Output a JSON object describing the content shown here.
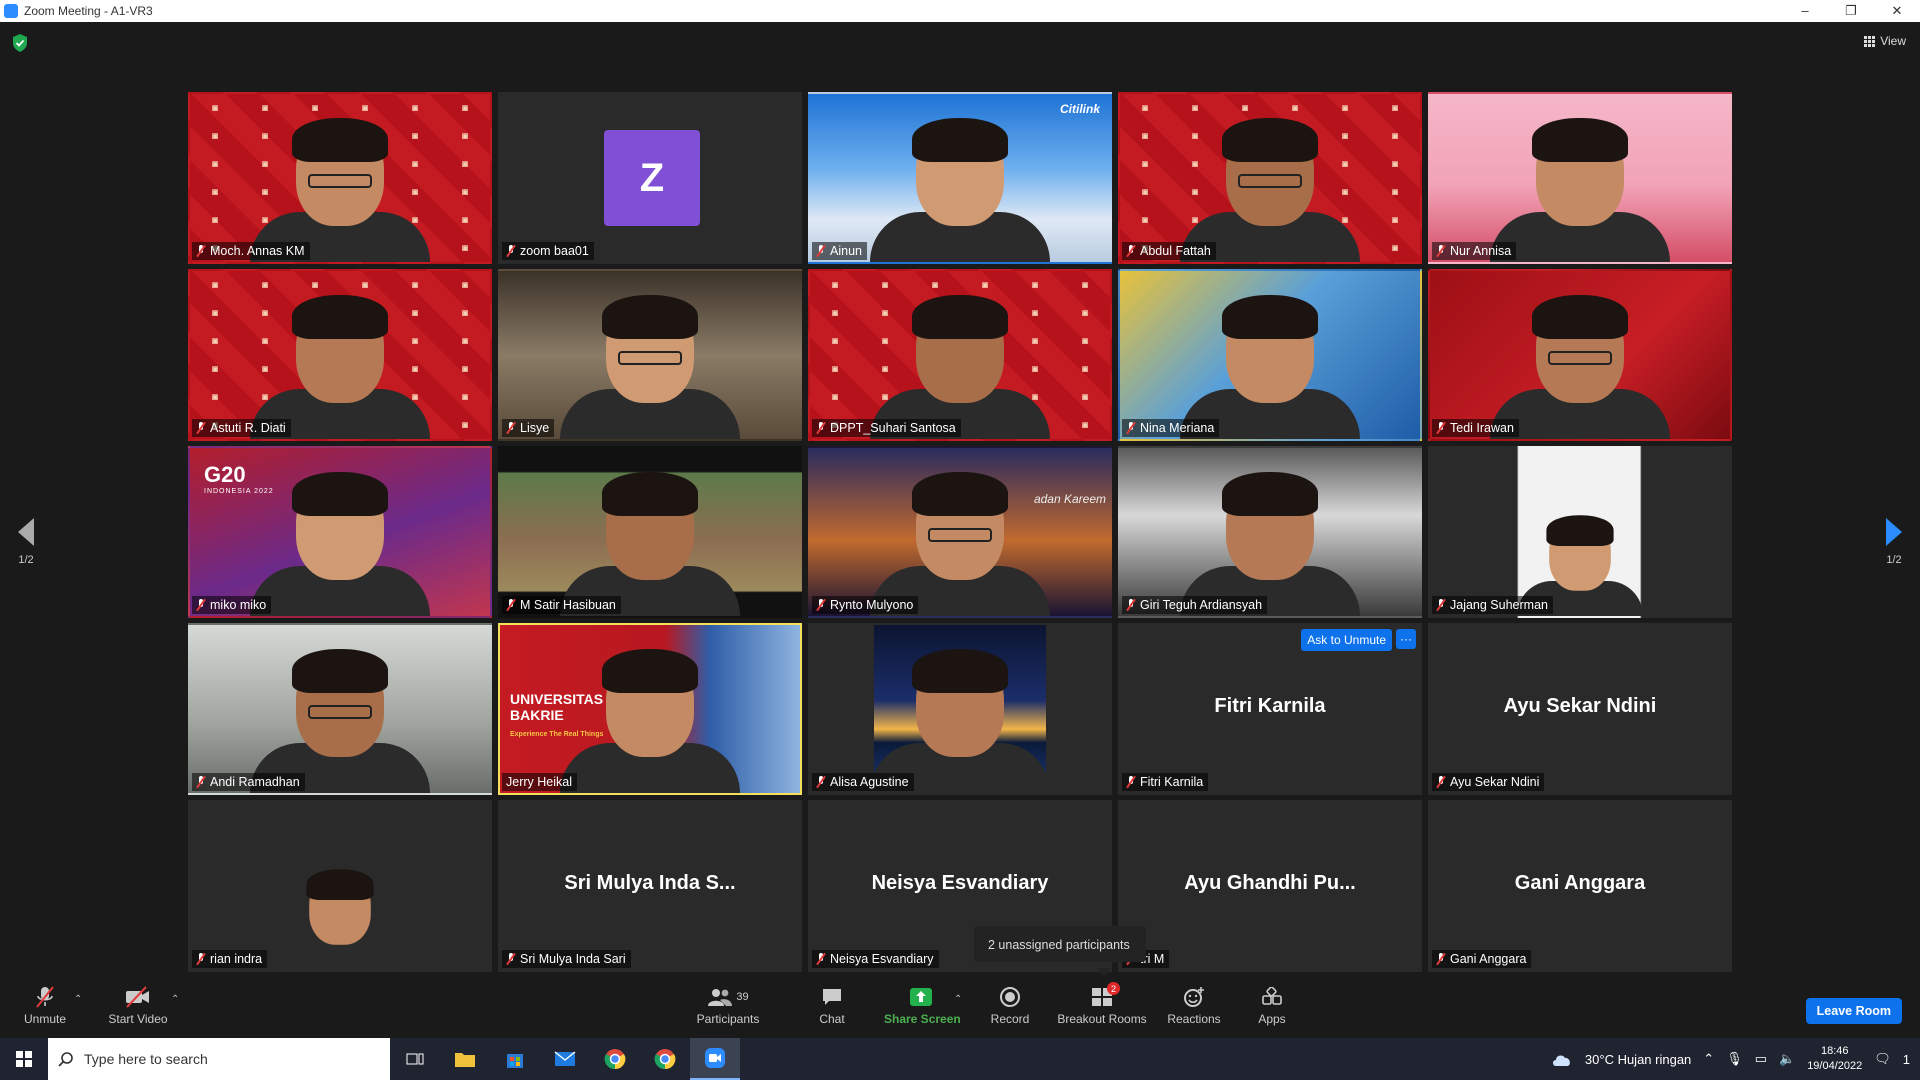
{
  "window": {
    "title": "Zoom Meeting - A1-VR3",
    "minimize": "–",
    "maximize": "❐",
    "close": "✕"
  },
  "header": {
    "view_label": "View"
  },
  "tiles": [
    {
      "name": "Moch. Annas KM",
      "bg": "bakrie"
    },
    {
      "name": "zoom baa01",
      "avatar": "Z"
    },
    {
      "name": "Ainun",
      "bg": "sky",
      "brand": "Citilink"
    },
    {
      "name": "Abdul Fattah",
      "bg": "bakrie"
    },
    {
      "name": "Nur Annisa",
      "bg": "cartoon"
    },
    {
      "name": "Astuti R. Diati",
      "bg": "bakrie"
    },
    {
      "name": "Lisye",
      "bg": "office"
    },
    {
      "name": "DPPT_Suhari Santosa",
      "bg": "bakrie"
    },
    {
      "name": "Nina Meriana",
      "bg": "building"
    },
    {
      "name": "Tedi Irawan",
      "bg": "red"
    },
    {
      "name": "miko miko",
      "bg": "g20",
      "g20": "G20",
      "g20_sub": "INDONESIA 2022"
    },
    {
      "name": "M Satir Hasibuan",
      "bg": "temple"
    },
    {
      "name": "Rynto Mulyono",
      "bg": "ramadan",
      "ramadan": "adan Kareem"
    },
    {
      "name": "Giri Teguh Ardiansyah",
      "bg": "grey"
    },
    {
      "name": "Jajang Suherman",
      "bg": "white"
    },
    {
      "name": "Andi Ramadhan",
      "bg": "room"
    },
    {
      "name": "Jerry Heikal",
      "bg": "univ",
      "uni_line1": "UNIVERSITAS",
      "uni_line2": "BAKRIE",
      "uni_tag": "Experience The Real Things",
      "speaking": true
    },
    {
      "name": "Alisa Agustine",
      "bg": "city"
    },
    {
      "name": "Fitri Karnila",
      "center_name": "Fitri Karnila",
      "ask_unmute": "Ask to Unmute",
      "more": "···"
    },
    {
      "name": "Ayu Sekar Ndini",
      "center_name": "Ayu Sekar Ndini"
    },
    {
      "name": "rian indra",
      "bg": "photo"
    },
    {
      "name": "Sri Mulya Inda Sari",
      "center_name": "Sri Mulya Inda S..."
    },
    {
      "name": "Neisya Esvandiary",
      "center_name": "Neisya Esvandiary"
    },
    {
      "name": "tri M",
      "center_name": "Ayu Ghandhi Pu..."
    },
    {
      "name": "Gani Anggara",
      "center_name": "Gani Anggara"
    }
  ],
  "pagination": {
    "left": "1/2",
    "right": "1/2"
  },
  "tooltip": {
    "unassigned": "2 unassigned participants"
  },
  "toolbar": {
    "unmute": "Unmute",
    "start_video": "Start Video",
    "participants": "Participants",
    "participants_count": "39",
    "chat": "Chat",
    "share_screen": "Share Screen",
    "record": "Record",
    "breakout_rooms": "Breakout Rooms",
    "breakout_badge": "2",
    "reactions": "Reactions",
    "apps": "Apps",
    "leave": "Leave Room"
  },
  "taskbar": {
    "search_placeholder": "Type here to search",
    "weather": "30°C  Hujan ringan",
    "time": "18:46",
    "date": "19/04/2022",
    "notification_count": "1"
  },
  "colors": {
    "zoom_blue": "#0e72ed",
    "share_green": "#4caf50",
    "speaking": "#f4e05d",
    "avatar_purple": "#7f4fd6"
  }
}
